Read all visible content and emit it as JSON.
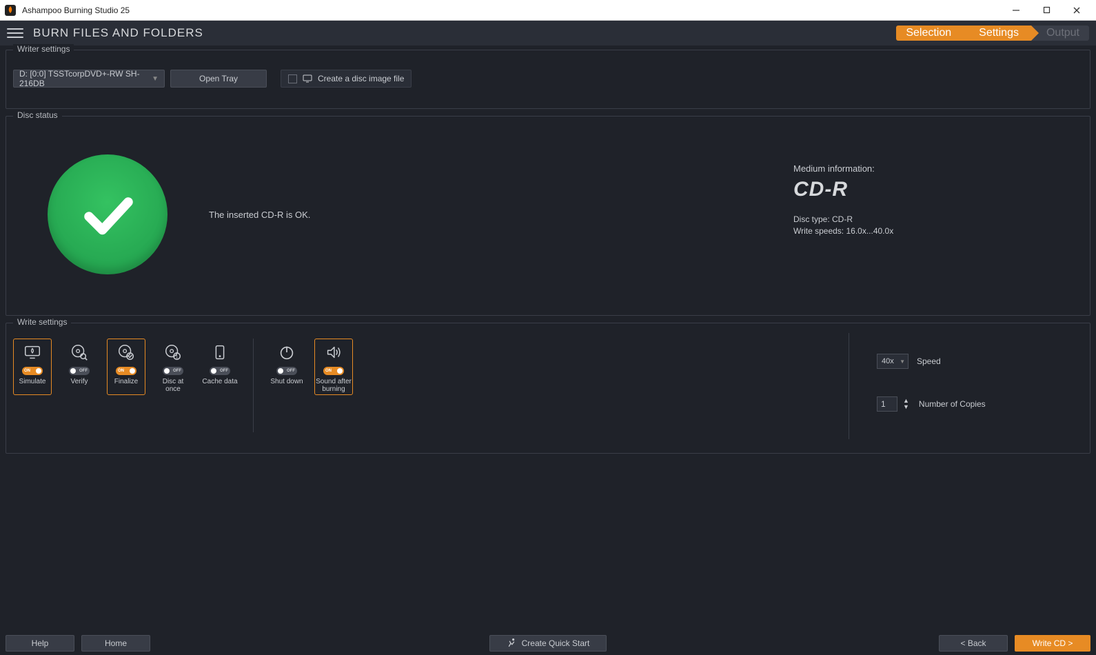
{
  "titlebar": {
    "app_title": "Ashampoo Burning Studio 25"
  },
  "header": {
    "page_title": "BURN FILES AND FOLDERS",
    "steps": {
      "selection": "Selection",
      "settings": "Settings",
      "output": "Output"
    }
  },
  "writer_settings": {
    "legend": "Writer settings",
    "drive_selected": "D: [0:0] TSSTcorpDVD+-RW SH-216DB",
    "open_tray": "Open Tray",
    "create_image": "Create a disc image file"
  },
  "disc_status": {
    "legend": "Disc status",
    "message": "The inserted CD-R is OK.",
    "medium_info_label": "Medium information:",
    "medium_name": "CD-R",
    "disc_type": "Disc type: CD-R",
    "write_speeds": "Write speeds: 16.0x...40.0x"
  },
  "write_settings": {
    "legend": "Write settings",
    "toggles": {
      "simulate": {
        "label": "Simulate",
        "state": "ON"
      },
      "verify": {
        "label": "Verify",
        "state": "OFF"
      },
      "finalize": {
        "label": "Finalize",
        "state": "ON"
      },
      "discatonce": {
        "label": "Disc at once",
        "state": "OFF"
      },
      "cachedata": {
        "label": "Cache data",
        "state": "OFF"
      },
      "shutdown": {
        "label": "Shut down",
        "state": "OFF"
      },
      "sound": {
        "label": "Sound after burning",
        "state": "ON"
      }
    },
    "speed_value": "40x",
    "speed_label": "Speed",
    "copies_value": "1",
    "copies_label": "Number of Copies"
  },
  "footer": {
    "help": "Help",
    "home": "Home",
    "quick_start": "Create Quick Start",
    "back": "< Back",
    "write": "Write CD >"
  }
}
